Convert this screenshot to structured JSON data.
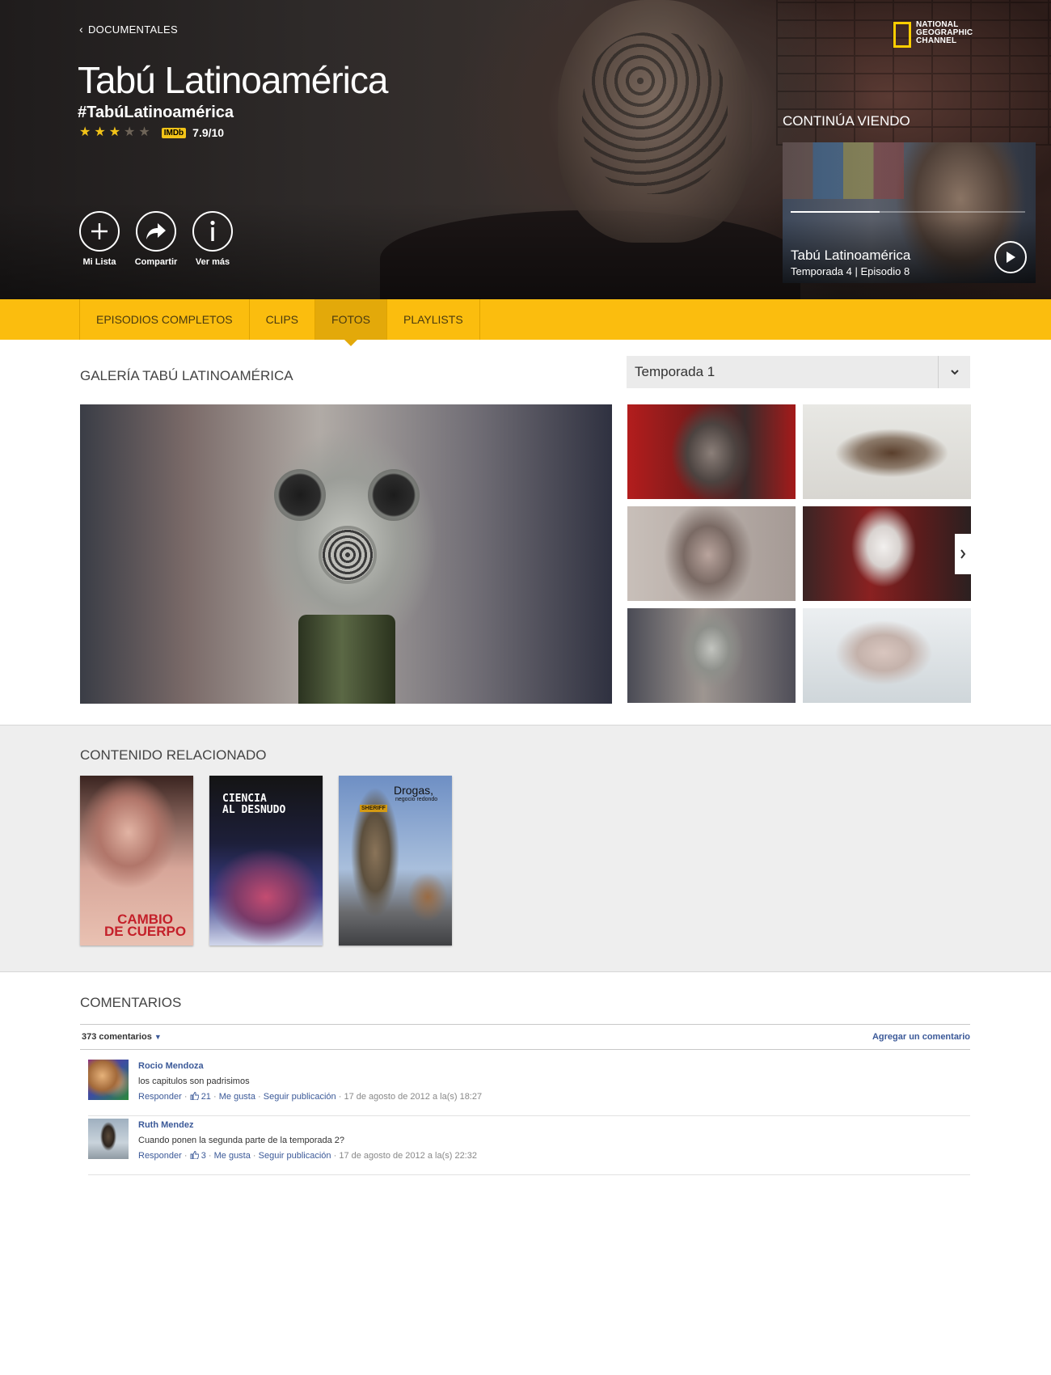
{
  "hero": {
    "back_label": "DOCUMENTALES",
    "channel_logo": [
      "NATIONAL",
      "GEOGRAPHIC",
      "CHANNEL"
    ],
    "title": "Tabú Latinoamérica",
    "hashtag": "#TabúLatinoamérica",
    "stars": 3,
    "stars_max": 5,
    "imdb_badge": "IMDb",
    "imdb_score": "7.9/10",
    "actions": [
      {
        "label": "Mi Lista",
        "icon": "plus-icon"
      },
      {
        "label": "Compartir",
        "icon": "share-icon"
      },
      {
        "label": "Ver más",
        "icon": "info-icon"
      }
    ]
  },
  "continue_watching": {
    "heading": "CONTINÚA VIENDO",
    "title": "Tabú Latinoamérica",
    "subtitle": "Temporada 4 | Episodio 8",
    "progress": 0.38,
    "icon": "play-icon"
  },
  "tabs": [
    {
      "label": "EPISODIOS COMPLETOS",
      "active": false
    },
    {
      "label": "CLIPS",
      "active": false
    },
    {
      "label": "FOTOS",
      "active": true
    },
    {
      "label": "PLAYLISTS",
      "active": false
    }
  ],
  "gallery": {
    "heading": "GALERÍA TABÚ LATINOAMÉRICA",
    "season_selected": "Temporada 1",
    "next_icon": "chevron-right-icon"
  },
  "related": {
    "heading": "CONTENIDO RELACIONADO",
    "cards": [
      {
        "title_line1": "CAMBIO",
        "title_line2": "DE CUERPO"
      },
      {
        "title_line1": "CIENCIA",
        "title_line2": "AL DESNUDO"
      },
      {
        "title_line1": "Drogas,",
        "title_line2": "negocio redondo",
        "badge": "SHERIFF"
      }
    ]
  },
  "comments": {
    "heading": "COMENTARIOS",
    "count_label": "373 comentarios",
    "add_label": "Agregar un comentario",
    "items": [
      {
        "author": "Rocio Mendoza",
        "text": "los capitulos son padrisimos",
        "reply": "Responder",
        "likes": "21",
        "like": "Me gusta",
        "follow": "Seguir publicación",
        "date": "17 de agosto de 2012 a la(s) 18:27"
      },
      {
        "author": "Ruth Mendez",
        "text": "Cuando ponen la segunda parte de la temporada 2?",
        "reply": "Responder",
        "likes": "3",
        "like": "Me gusta",
        "follow": "Seguir publicación",
        "date": "17 de agosto de 2012 a la(s) 22:32"
      }
    ]
  },
  "colors": {
    "accent_yellow": "#fbbd0e",
    "active_tab": "#e3a90a",
    "facebook_blue": "#3b5998",
    "star": "#f2c318"
  }
}
